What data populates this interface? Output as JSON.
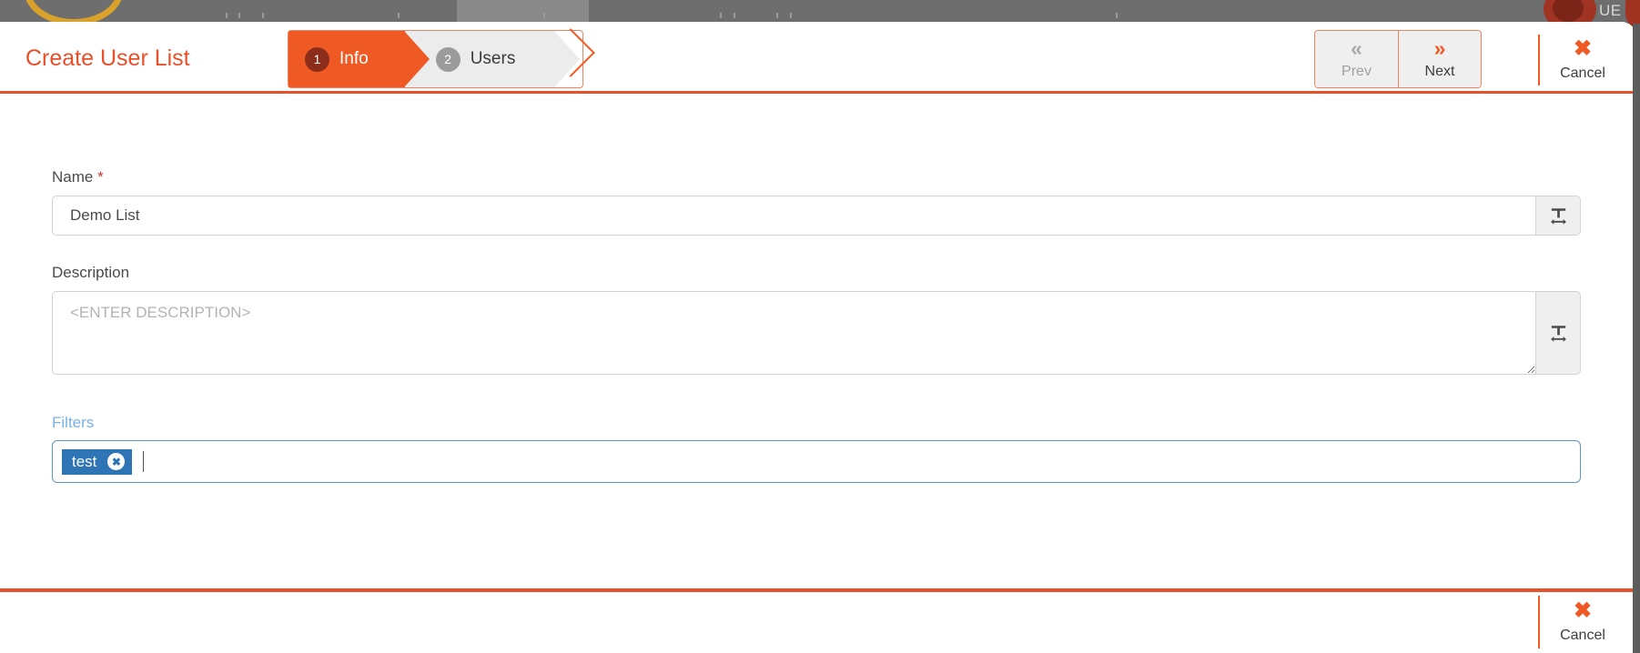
{
  "modal": {
    "title": "Create User List"
  },
  "wizard": {
    "steps": [
      {
        "number": "1",
        "label": "Info",
        "state": "active"
      },
      {
        "number": "2",
        "label": "Users",
        "state": "inactive"
      }
    ]
  },
  "header": {
    "prev": {
      "label": "Prev",
      "icon": "chevron-double-left-icon",
      "glyph": "«",
      "enabled": false
    },
    "next": {
      "label": "Next",
      "icon": "chevron-double-right-icon",
      "glyph": "»",
      "enabled": true
    },
    "cancel": {
      "label": "Cancel",
      "icon": "close-x-icon",
      "glyph": "✖"
    }
  },
  "form": {
    "name": {
      "label": "Name",
      "required_marker": "*",
      "value": "Demo List",
      "placeholder": "",
      "addon_icon": "translate-text-icon"
    },
    "description": {
      "label": "Description",
      "value": "",
      "placeholder": "<ENTER DESCRIPTION>",
      "addon_icon": "translate-text-icon"
    },
    "filters": {
      "label": "Filters",
      "tags": [
        {
          "text": "test",
          "remove_icon": "remove-circle-x-icon",
          "remove_glyph": "✖"
        }
      ],
      "input_value": "",
      "placeholder": ""
    }
  },
  "footer": {
    "cancel": {
      "label": "Cancel",
      "icon": "close-x-icon",
      "glyph": "✖"
    }
  },
  "colors": {
    "brand_orange": "#e8502a",
    "step_active": "#ef5a24",
    "step_active_badge": "#8c2d1c",
    "step_inactive": "#ececec",
    "step_inactive_badge": "#9b9b9b",
    "filters_label_blue": "#78b2e4",
    "filters_border_blue": "#5f95c9",
    "chip_blue": "#2f74b5",
    "required_red": "#c0392b",
    "addon_gray": "#efefef"
  },
  "background": {
    "topbar_color": "#6e6e6e"
  }
}
